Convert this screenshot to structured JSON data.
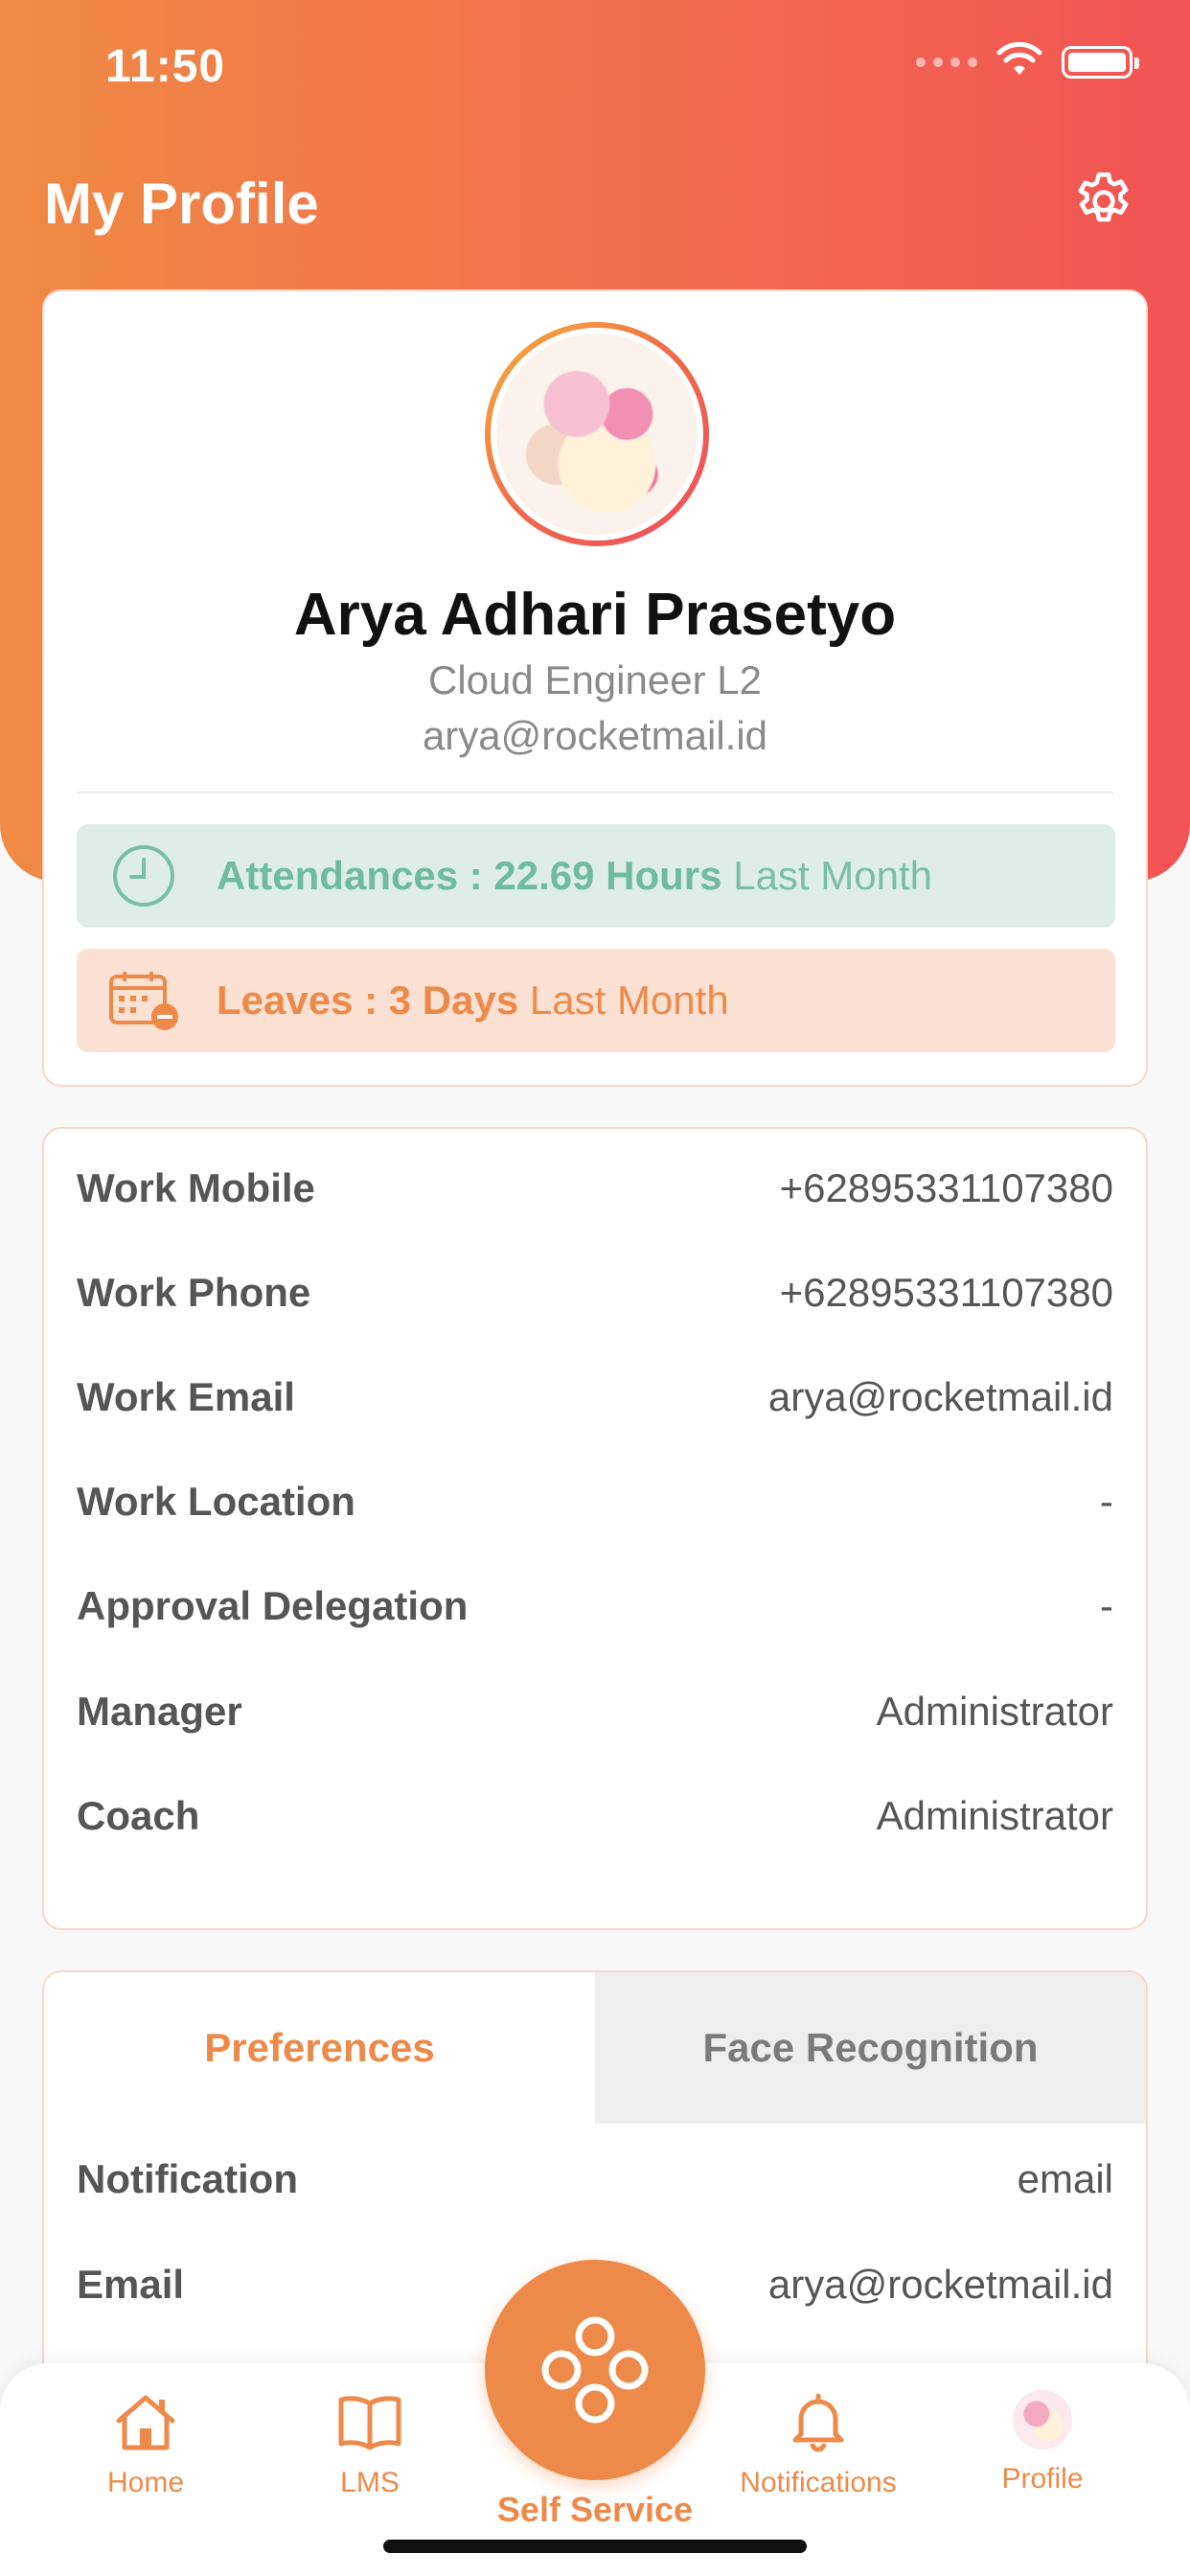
{
  "status_bar": {
    "time": "11:50"
  },
  "header": {
    "title": "My Profile",
    "settings_icon": "gear-icon"
  },
  "profile": {
    "name": "Arya Adhari Prasetyo",
    "job_title": "Cloud Engineer L2",
    "email": "arya@rocketmail.id",
    "attendance": {
      "label": "Attendances : 22.69 Hours",
      "period": "Last Month",
      "icon": "clock-icon"
    },
    "leaves": {
      "label": "Leaves : 3 Days",
      "period": "Last Month",
      "icon": "calendar-minus-icon"
    }
  },
  "work_info": [
    {
      "label": "Work Mobile",
      "value": "+62895331107380"
    },
    {
      "label": "Work Phone",
      "value": "+62895331107380"
    },
    {
      "label": "Work Email",
      "value": "arya@rocketmail.id"
    },
    {
      "label": "Work Location",
      "value": "-"
    },
    {
      "label": "Approval Delegation",
      "value": "-"
    },
    {
      "label": "Manager",
      "value": "Administrator"
    },
    {
      "label": "Coach",
      "value": "Administrator"
    }
  ],
  "tabs": {
    "preferences": "Preferences",
    "face_recognition": "Face Recognition"
  },
  "preferences": [
    {
      "label": "Notification",
      "value": "email"
    },
    {
      "label": "Email",
      "value": "arya@rocketmail.id"
    }
  ],
  "bottom_nav": {
    "home": "Home",
    "lms": "LMS",
    "self_service": "Self Service",
    "notifications": "Notifications",
    "profile": "Profile"
  },
  "colors": {
    "accent": "#ee8a49",
    "header_gradient_start": "#f08a44",
    "header_gradient_end": "#f25354",
    "attendance": "#6ebb9f"
  }
}
